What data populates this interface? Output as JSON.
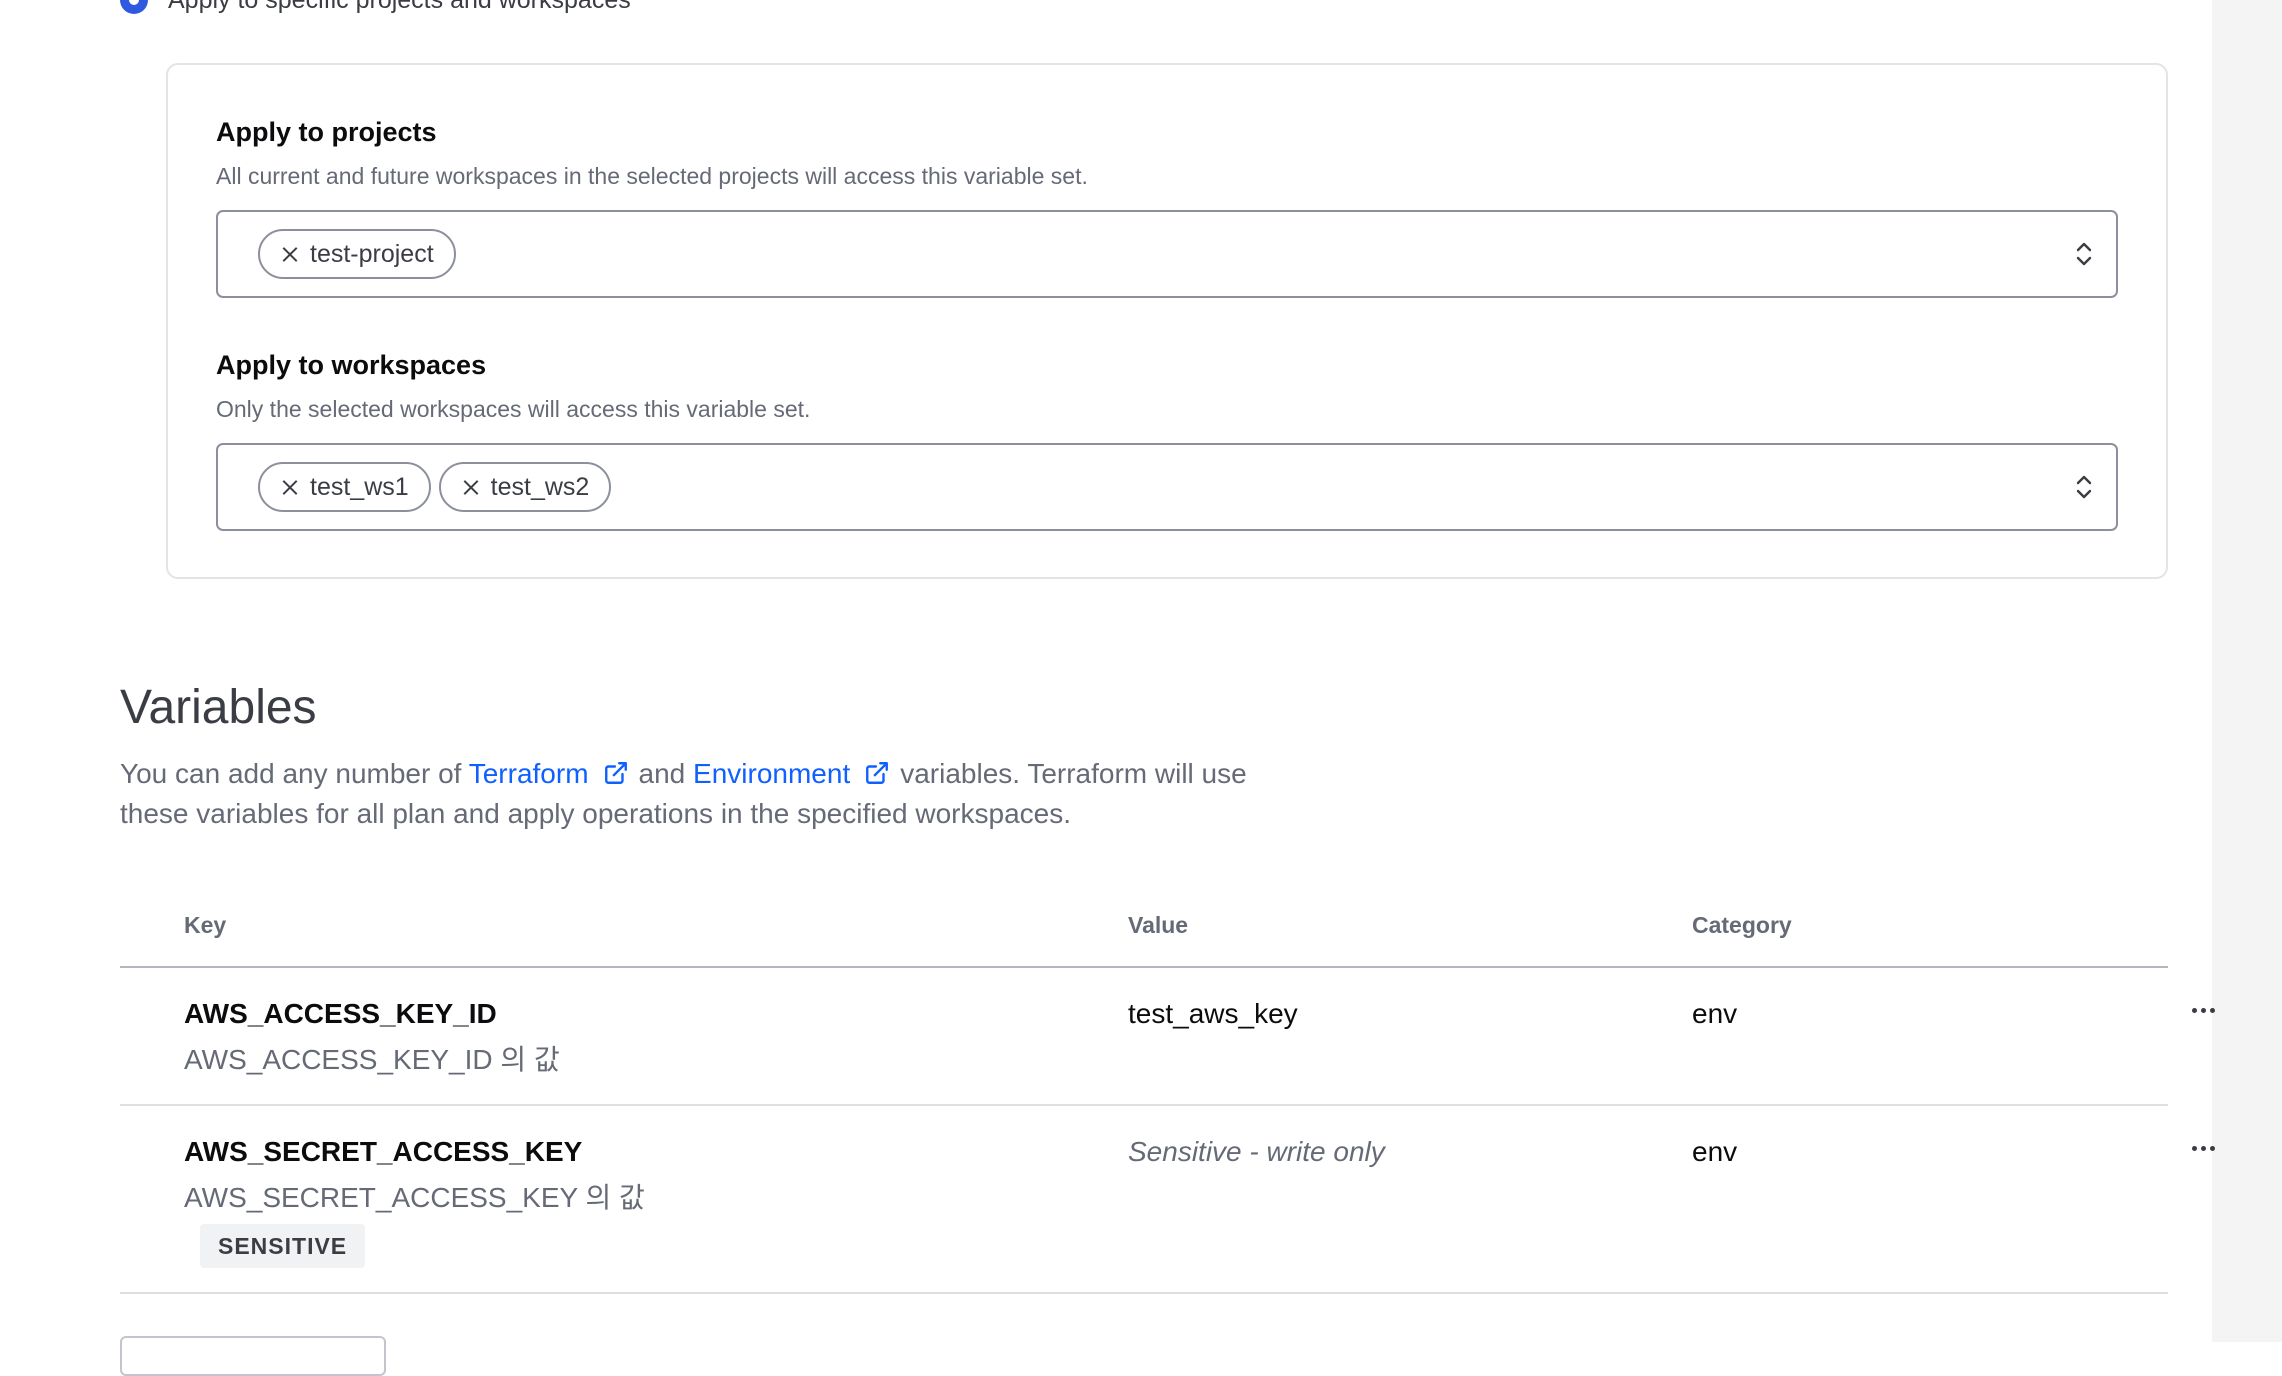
{
  "scope": {
    "radio_label": "Apply to specific projects and workspaces",
    "projects": {
      "title": "Apply to projects",
      "help": "All current and future workspaces in the selected projects will access this variable set.",
      "chips": [
        "test-project"
      ]
    },
    "workspaces": {
      "title": "Apply to workspaces",
      "help": "Only the selected workspaces will access this variable set.",
      "chips": [
        "test_ws1",
        "test_ws2"
      ]
    }
  },
  "variables": {
    "title": "Variables",
    "desc_prefix": "You can add any number of",
    "link_terraform": "Terraform",
    "desc_and": "and",
    "link_environment": "Environment",
    "desc_suffix": "variables. Terraform will use these variables for all plan and apply operations in the specified workspaces."
  },
  "table": {
    "headers": {
      "key": "Key",
      "value": "Value",
      "category": "Category"
    },
    "rows": [
      {
        "key": "AWS_ACCESS_KEY_ID",
        "description": "AWS_ACCESS_KEY_ID 의 값",
        "value": "test_aws_key",
        "category": "env"
      },
      {
        "key": "AWS_SECRET_ACCESS_KEY",
        "description": "AWS_SECRET_ACCESS_KEY 의 값",
        "value": "Sensitive - write only",
        "category": "env",
        "badge": "SENSITIVE"
      }
    ]
  },
  "colors": {
    "accent": "#2f59e0",
    "link": "#1060ff",
    "text_primary": "#0c0c0e",
    "text_secondary": "#656a76"
  }
}
